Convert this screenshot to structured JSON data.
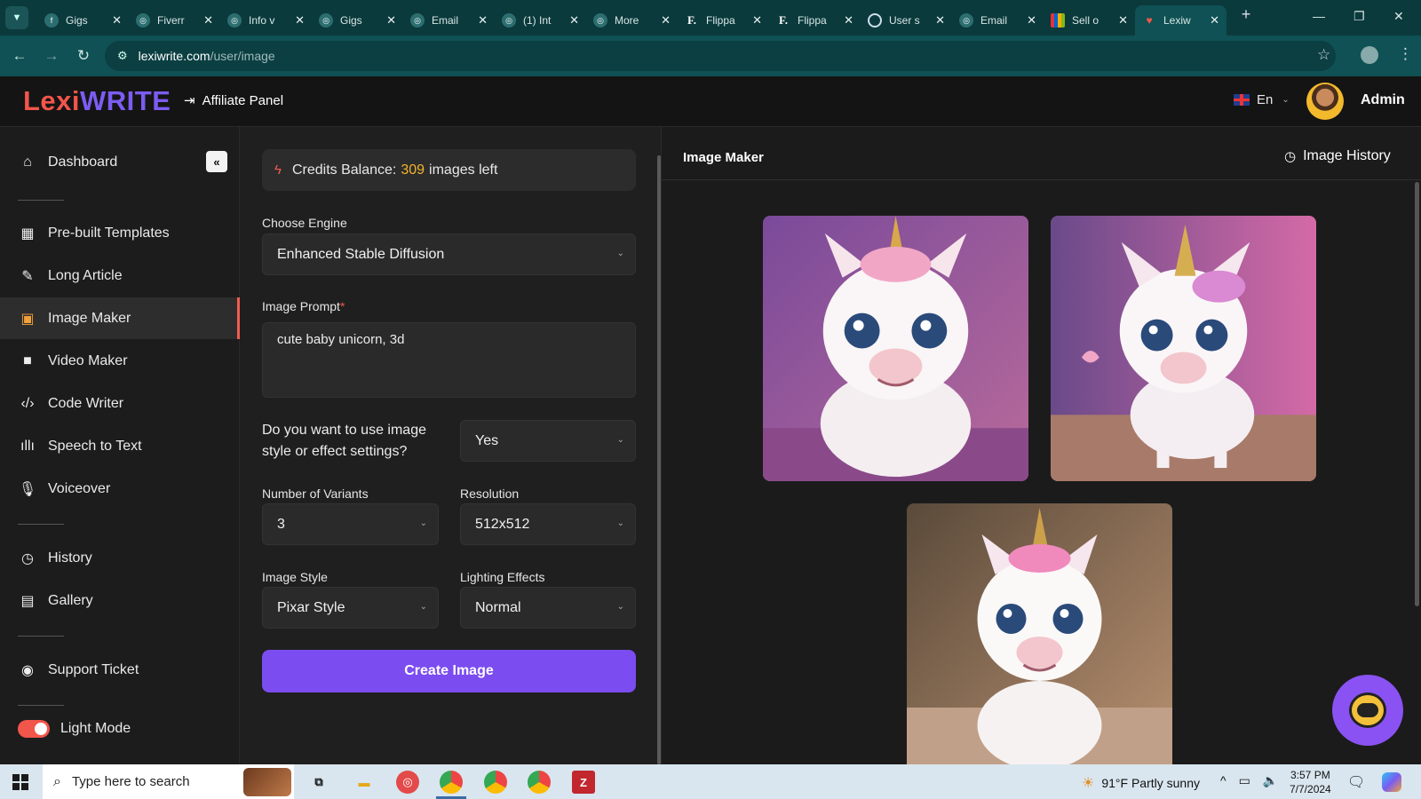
{
  "browser": {
    "tabs": [
      {
        "label": "Gigs",
        "icon": "fiverr-icon",
        "active": false
      },
      {
        "label": "Fiverr",
        "icon": "chatgpt-icon",
        "active": false
      },
      {
        "label": "Info v",
        "icon": "chatgpt-icon",
        "active": false
      },
      {
        "label": "Gigs",
        "icon": "chatgpt-icon",
        "active": false
      },
      {
        "label": "Email",
        "icon": "chatgpt-icon",
        "active": false
      },
      {
        "label": "(1) Int",
        "icon": "chatgpt-icon",
        "active": false
      },
      {
        "label": "More",
        "icon": "chatgpt-icon",
        "active": false
      },
      {
        "label": "Flippa",
        "icon": "flippa-icon",
        "active": false
      },
      {
        "label": "Flippa",
        "icon": "flippa-icon",
        "active": false
      },
      {
        "label": "User s",
        "icon": "loading-icon",
        "active": false
      },
      {
        "label": "Email",
        "icon": "chatgpt-icon",
        "active": false
      },
      {
        "label": "Sell o",
        "icon": "ebay-icon",
        "active": false
      },
      {
        "label": "Lexiw",
        "icon": "lexiwrite-icon",
        "active": true
      }
    ],
    "url_host": "lexiwrite.com",
    "url_path": "/user/image"
  },
  "header": {
    "logo_part1": "Lexi",
    "logo_part2": "WRITE",
    "affiliate_label": "Affiliate Panel",
    "language": "En",
    "user_name": "Admin"
  },
  "sidebar": {
    "items": [
      {
        "label": "Dashboard",
        "icon": "home-icon"
      },
      {
        "label": "Pre-built Templates",
        "icon": "grid-icon"
      },
      {
        "label": "Long Article",
        "icon": "pen-icon"
      },
      {
        "label": "Image Maker",
        "icon": "image-icon"
      },
      {
        "label": "Video Maker",
        "icon": "video-icon"
      },
      {
        "label": "Code Writer",
        "icon": "code-icon"
      },
      {
        "label": "Speech to Text",
        "icon": "waveform-icon"
      },
      {
        "label": "Voiceover",
        "icon": "microphone-icon"
      },
      {
        "label": "History",
        "icon": "history-icon"
      },
      {
        "label": "Gallery",
        "icon": "gallery-icon"
      },
      {
        "label": "Support Ticket",
        "icon": "support-icon"
      },
      {
        "label": "Light Mode",
        "icon": "toggle-icon"
      }
    ]
  },
  "form": {
    "credits_prefix": "Credits Balance:",
    "credits_count": "309",
    "credits_suffix": "images left",
    "engine_label": "Choose Engine",
    "engine_value": "Enhanced Stable Diffusion",
    "prompt_label": "Image Prompt",
    "prompt_required": "*",
    "prompt_value": "cute baby unicorn, 3d",
    "style_question": "Do you want to use image style or effect settings?",
    "style_toggle_value": "Yes",
    "variants_label": "Number of Variants",
    "variants_value": "3",
    "resolution_label": "Resolution",
    "resolution_value": "512x512",
    "image_style_label": "Image Style",
    "image_style_value": "Pixar Style",
    "lighting_label": "Lighting Effects",
    "lighting_value": "Normal",
    "create_button": "Create Image"
  },
  "results": {
    "title": "Image Maker",
    "history_label": "Image History"
  },
  "taskbar": {
    "search_placeholder": "Type here to search",
    "weather": "91°F  Partly sunny",
    "time": "3:57 PM",
    "date": "7/7/2024"
  }
}
